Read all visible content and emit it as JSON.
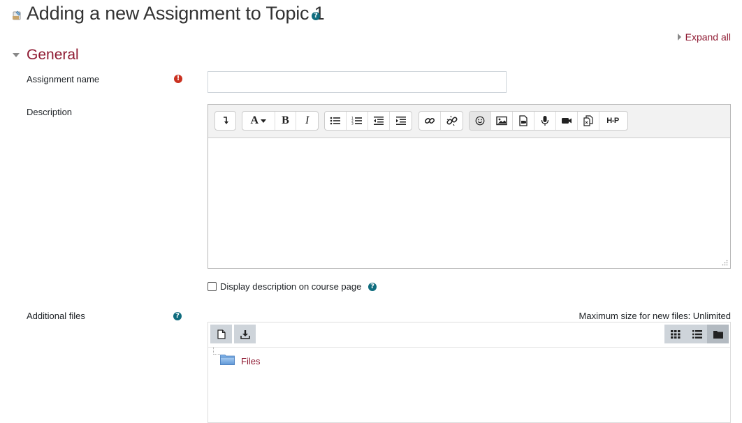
{
  "header": {
    "title": "Adding a new Assignment to Topic 1",
    "help_icon": "?",
    "expand_all": "Expand all"
  },
  "section": {
    "title": "General"
  },
  "fields": {
    "assignment_name": {
      "label": "Assignment name",
      "value": "",
      "required_icon": "!"
    },
    "description": {
      "label": "Description",
      "value": ""
    },
    "display_description": {
      "label": "Display description on course page",
      "checked": false
    },
    "additional_files": {
      "label": "Additional files",
      "max_size": "Maximum size for new files: Unlimited",
      "folder_label": "Files"
    }
  },
  "editor_toolbar": {
    "groups": [
      [
        "collapse-icon"
      ],
      [
        "font-style-icon",
        "bold-icon",
        "italic-icon"
      ],
      [
        "unordered-list-icon",
        "ordered-list-icon",
        "outdent-icon",
        "indent-icon"
      ],
      [
        "link-icon",
        "unlink-icon"
      ],
      [
        "emoticon-icon",
        "image-icon",
        "media-icon",
        "record-audio-icon",
        "record-video-icon",
        "manage-files-icon",
        "h5p-icon"
      ]
    ],
    "h5p_label": "H-P"
  },
  "colors": {
    "accent": "#8f1a32",
    "help": "#0f6c7e",
    "required": "#ca3120"
  }
}
